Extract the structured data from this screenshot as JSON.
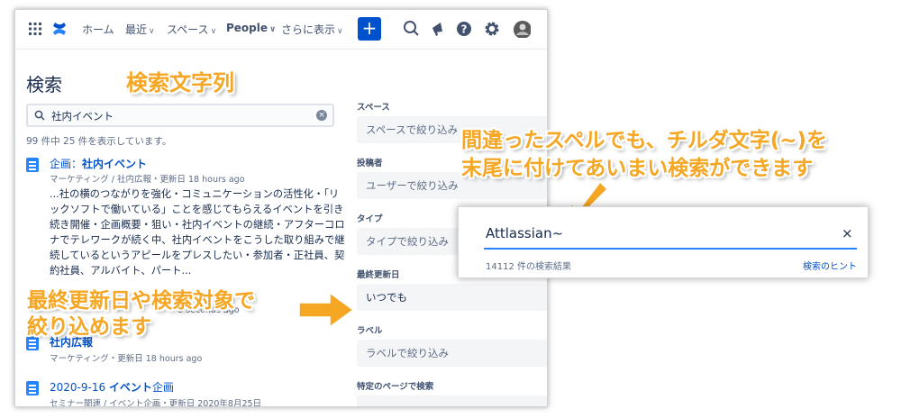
{
  "nav": {
    "home": "ホーム",
    "recent": "最近",
    "spaces": "スペース",
    "people": "People",
    "more": "さらに表示",
    "create": "+"
  },
  "page": {
    "title": "検索"
  },
  "search": {
    "value": "社内イベント",
    "result_count": "99 件中 25 件を表示しています。"
  },
  "results": [
    {
      "title_pre": "企画：",
      "title_hl": "社内イベント",
      "title_post": "",
      "meta": "マーケティング / 社内広報・更新日 18 hours ago",
      "snippet": [
        "...社の横のつながりを強化・コミュニケーションの活性化・「リ",
        "ックソフトで働いている」ことを感じてもらえるイベントを引き",
        "続き開催・企画概要・狙い・社内イベントの継続・アフターコロ",
        "ナでテレワークが続く中、社内イベントをこうした取り組みで継",
        "続しているというアピールをプレスしたい・参加者・正社員、契",
        "約社員、アルバイト、パート..."
      ]
    },
    {
      "meta_partial": "8 seconds ago"
    },
    {
      "title_pre": "",
      "title_hl": "社内広報",
      "title_post": "",
      "meta": "マーケティング・更新日 18 hours ago"
    },
    {
      "title_pre": "2020-9-16 ",
      "title_hl": "イベント",
      "title_post": "企画",
      "meta": "セミナー関連 / イベント企画・更新日 2020年8月25日"
    }
  ],
  "filters": [
    {
      "label": "スペース",
      "placeholder": "スペースで絞り込み"
    },
    {
      "label": "投稿者",
      "placeholder": "ユーザーで絞り込み"
    },
    {
      "label": "タイプ",
      "placeholder": "タイプで絞り込み"
    },
    {
      "label": "最終更新日",
      "placeholder": "いつでも"
    },
    {
      "label": "ラベル",
      "placeholder": "ラベルで絞り込み"
    },
    {
      "label": "特定のページで検索",
      "placeholder": ""
    }
  ],
  "callouts": {
    "search_string": "検索文字列",
    "fuzzy_line1": "間違ったスペルでも、チルダ文字(~)を",
    "fuzzy_line2": "末尾に付けてあいまい検索ができます",
    "filter_line1": "最終更新日や検索対象で",
    "filter_line2": "絞り込めます"
  },
  "inset": {
    "input": "Attlassian~",
    "count": "14112 件の検索結果",
    "hint": "検索のヒント",
    "close": "×"
  },
  "colors": {
    "accent": "#0052cc",
    "callout": "#f5a623"
  }
}
